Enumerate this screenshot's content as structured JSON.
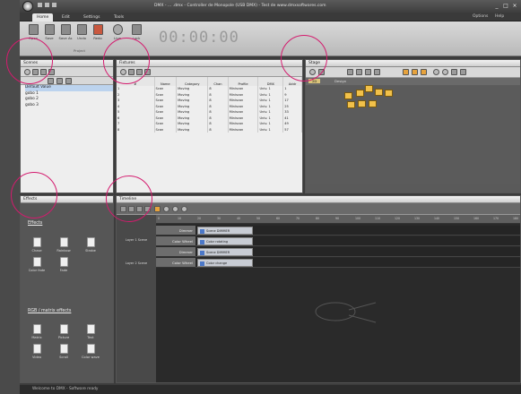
{
  "app": {
    "title": "DMX - ... .dmx - Controller de Monopole (USB DMX) - Test de www.dmxsoftwares.com",
    "min": "_",
    "max": "□",
    "close": "×"
  },
  "menu": {
    "tabs": [
      "Home",
      "Edit",
      "Settings",
      "Tools"
    ],
    "right": [
      "Options",
      "Help"
    ]
  },
  "ribbon": {
    "buttons": [
      "Open",
      "Save",
      "Save As",
      "Undo",
      "Redo",
      "Live",
      "Lock"
    ],
    "group_label": "Project",
    "timer": "00:00:00"
  },
  "panels": {
    "scenes": {
      "title": "Scenes",
      "items": [
        "Default Value",
        "gobo 1",
        "gobo 2",
        "gobo 3"
      ]
    },
    "fixtures": {
      "title": "Fixtures",
      "columns": [
        "#",
        "Name",
        "Category",
        "Chan",
        "Profile",
        "DMX",
        "Addr"
      ],
      "rows": [
        [
          "1",
          "Scan",
          "Moving",
          "8",
          "Miniscan",
          "Univ. 1",
          "1"
        ],
        [
          "2",
          "Scan",
          "Moving",
          "8",
          "Miniscan",
          "Univ. 1",
          "9"
        ],
        [
          "3",
          "Scan",
          "Moving",
          "8",
          "Miniscan",
          "Univ. 1",
          "17"
        ],
        [
          "4",
          "Scan",
          "Moving",
          "8",
          "Miniscan",
          "Univ. 1",
          "25"
        ],
        [
          "5",
          "Scan",
          "Moving",
          "8",
          "Miniscan",
          "Univ. 1",
          "33"
        ],
        [
          "6",
          "Scan",
          "Moving",
          "8",
          "Miniscan",
          "Univ. 1",
          "41"
        ],
        [
          "7",
          "Scan",
          "Moving",
          "8",
          "Miniscan",
          "Univ. 1",
          "49"
        ],
        [
          "8",
          "Scan",
          "Moving",
          "8",
          "Miniscan",
          "Univ. 1",
          "57"
        ]
      ]
    },
    "stage": {
      "title": "Stage",
      "tabs": [
        "2D",
        "Design"
      ]
    },
    "effects": {
      "title": "Effects",
      "group1_title": "Effects",
      "group1": [
        "Chase",
        "Rainbow",
        "Strobe",
        "Color fade",
        "Fade"
      ],
      "group2_title": "RGB / matrix effects",
      "group2": [
        "Matrix",
        "Picture",
        "Text",
        "Video",
        "Scroll",
        "Color wave"
      ]
    },
    "timeline": {
      "title": "Timeline",
      "ruler": [
        "0",
        "10",
        "20",
        "30",
        "40",
        "50",
        "60",
        "70",
        "80",
        "90",
        "100",
        "110",
        "120",
        "130",
        "140",
        "150",
        "160",
        "170",
        "180"
      ],
      "side_labels": [
        "Layer 1\nScene",
        "Layer 2\nScene"
      ],
      "tracks": [
        {
          "name": "Dimmer",
          "chip": "Scene DIMMER"
        },
        {
          "name": "Color Wheel",
          "chip": "Color rotating"
        },
        {
          "name": "Dimmer",
          "chip": "Scene DIMMER"
        },
        {
          "name": "Color Wheel",
          "chip": "Color change"
        }
      ]
    }
  },
  "status": {
    "text": "Welcome to DMX - Software ready"
  },
  "colors": {
    "highlight": "#d41b6e",
    "ribbon": "#c8c8c8",
    "fixture": "#f2c14a"
  }
}
